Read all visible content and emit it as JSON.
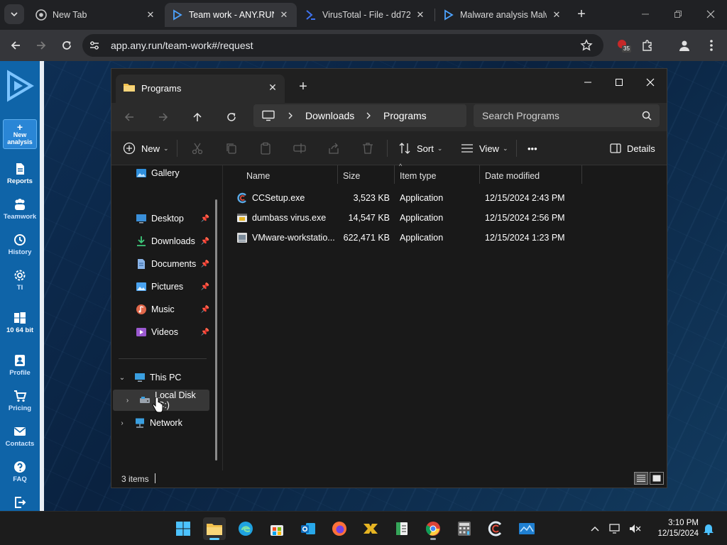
{
  "browser": {
    "tabs": [
      {
        "title": "New Tab",
        "icon": "chrome-icon"
      },
      {
        "title": "Team work - ANY.RUN",
        "icon": "anyrun-icon",
        "active": true
      },
      {
        "title": "VirusTotal - File - dd72",
        "icon": "virustotal-icon"
      },
      {
        "title": "Malware analysis Malw",
        "icon": "anyrun-icon"
      }
    ],
    "url": "app.any.run/team-work#/request",
    "extension_badge": "35"
  },
  "anyrun_sidebar": {
    "new_analysis": "New analysis",
    "items": [
      {
        "label": "Reports",
        "icon": "document-icon"
      },
      {
        "label": "Teamwork",
        "icon": "people-icon"
      },
      {
        "label": "History",
        "icon": "history-icon"
      },
      {
        "label": "TI",
        "icon": "gear-icon"
      },
      {
        "label": "10 64 bit",
        "icon": "windows-icon"
      },
      {
        "label": "Profile",
        "icon": "profile-icon"
      },
      {
        "label": "Pricing",
        "icon": "cart-icon"
      },
      {
        "label": "Contacts",
        "icon": "mail-icon"
      },
      {
        "label": "FAQ",
        "icon": "help-icon"
      }
    ]
  },
  "explorer": {
    "tab_title": "Programs",
    "breadcrumb": [
      "Downloads",
      "Programs"
    ],
    "search_placeholder": "Search Programs",
    "commands": {
      "new": "New",
      "sort": "Sort",
      "view": "View",
      "more": "•••",
      "details": "Details"
    },
    "nav": {
      "gallery": "Gallery",
      "quick_access": [
        {
          "label": "Desktop",
          "icon": "desktop-icon"
        },
        {
          "label": "Downloads",
          "icon": "download-icon"
        },
        {
          "label": "Documents",
          "icon": "documents-icon"
        },
        {
          "label": "Pictures",
          "icon": "pictures-icon"
        },
        {
          "label": "Music",
          "icon": "music-icon"
        },
        {
          "label": "Videos",
          "icon": "videos-icon"
        }
      ],
      "this_pc": "This PC",
      "local_disk": "Local Disk (C:)",
      "network": "Network"
    },
    "columns": {
      "name": "Name",
      "size": "Size",
      "type": "Item type",
      "date": "Date modified"
    },
    "files": [
      {
        "name": "CCSetup.exe",
        "size": "3,523 KB",
        "type": "Application",
        "date": "12/15/2024 2:43 PM",
        "icon": "ccleaner-icon"
      },
      {
        "name": "dumbass virus.exe",
        "size": "14,547 KB",
        "type": "Application",
        "date": "12/15/2024 2:56 PM",
        "icon": "exe-icon"
      },
      {
        "name": "VMware-workstatio...",
        "size": "622,471 KB",
        "type": "Application",
        "date": "12/15/2024 1:23 PM",
        "icon": "installer-icon"
      }
    ],
    "status": "3 items"
  },
  "taskbar": {
    "time": "3:10 PM",
    "date": "12/15/2024"
  },
  "colors": {
    "anyrun_blue": "#0f64a8",
    "accent": "#60cdff"
  }
}
